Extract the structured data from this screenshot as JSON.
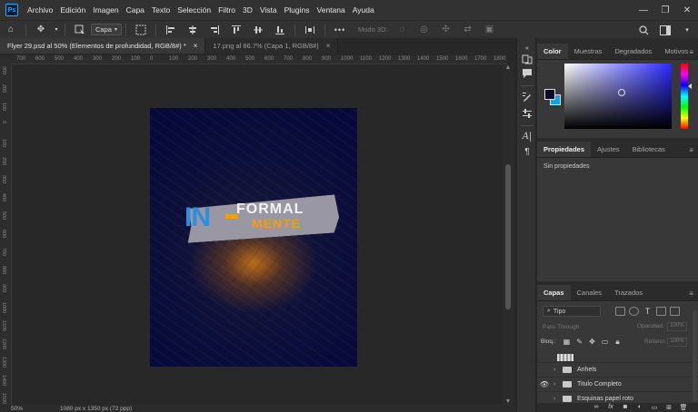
{
  "app": {
    "logo": "Ps",
    "menu": [
      "Archivo",
      "Edición",
      "Imagen",
      "Capa",
      "Texto",
      "Selección",
      "Filtro",
      "3D",
      "Vista",
      "Plugins",
      "Ventana",
      "Ayuda"
    ],
    "window_controls": [
      "—",
      "❐",
      "✕"
    ]
  },
  "options_bar": {
    "layer_select": "Capa",
    "mode3d_label": "Modo 3D:",
    "more": "•••"
  },
  "tabs": [
    {
      "label": "Flyer 29.psd al 50% (Elementos de profundidad, RGB/8#) *",
      "close": "×",
      "active": true
    },
    {
      "label": "17.png al 66.7% (Capa 1, RGB/8#)",
      "close": "×",
      "active": false
    }
  ],
  "rulers": {
    "horizontal": [
      "700",
      "600",
      "500",
      "400",
      "300",
      "200",
      "100",
      "0",
      "100",
      "200",
      "300",
      "400",
      "500",
      "600",
      "700",
      "800",
      "900",
      "1000",
      "1100",
      "1200",
      "1300",
      "1400",
      "1500",
      "1600",
      "1700",
      "1800"
    ],
    "vertical": [
      "300",
      "200",
      "100",
      "0",
      "100",
      "200",
      "300",
      "400",
      "500",
      "600",
      "700",
      "800",
      "900",
      "1000",
      "1100",
      "1200",
      "1300",
      "1400",
      "1500"
    ]
  },
  "artwork": {
    "logo_in": "IN",
    "logo_formal": "FORMAL",
    "logo_mente": "MENTE",
    "colors": {
      "background": "#0c0f3a",
      "glow": "#d67a14",
      "blue": "#2a8fe0",
      "orange": "#f29c1a",
      "tape": "#9a97a4"
    }
  },
  "status": {
    "zoom": "50%",
    "doc_info": "1080 px x 1350 px (72 ppp)"
  },
  "color_panel": {
    "tabs": [
      "Color",
      "Muestras",
      "Degradados",
      "Motivos"
    ],
    "active_tab": "Color",
    "foreground": "#0a0a2a",
    "background": "#14a0e8"
  },
  "properties_panel": {
    "tabs": [
      "Propiedades",
      "Ajustes",
      "Bibliotecas"
    ],
    "active_tab": "Propiedades",
    "empty_text": "Sin propiedades"
  },
  "layers_panel": {
    "tabs": [
      "Capas",
      "Canales",
      "Trazados"
    ],
    "active_tab": "Capas",
    "filter_label": "Tipo",
    "blend_mode": "Pass Through",
    "opacity_label": "Opacidad:",
    "opacity_value": "100%",
    "lock_label": "Bloq.:",
    "fill_label": "Relleno:",
    "fill_value": "100%",
    "layers": [
      {
        "name": "Anhels",
        "visible": false
      },
      {
        "name": "Titulo Completo",
        "visible": true
      },
      {
        "name": "Esquinas papel roto",
        "visible": false
      }
    ],
    "footer_icons": [
      "link-icon",
      "fx-icon",
      "mask-icon",
      "adjustment-icon",
      "folder-icon",
      "new-layer-icon",
      "trash-icon"
    ]
  }
}
